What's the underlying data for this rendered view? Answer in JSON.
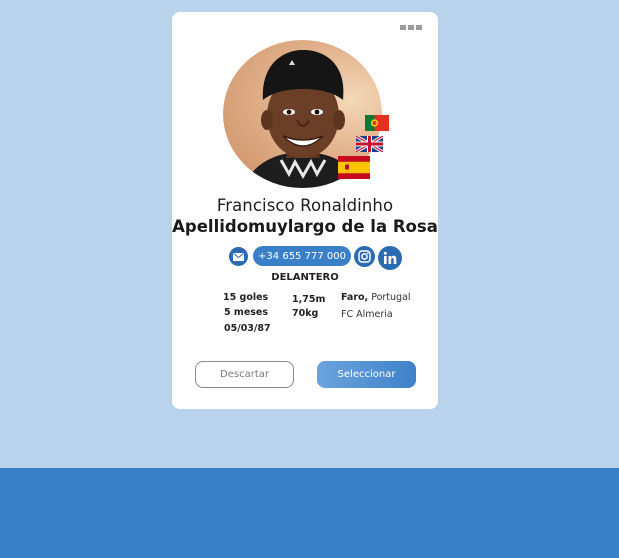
{
  "colors": {
    "background": "#b9d3ec",
    "bottom_band": "#3a80c8",
    "card": "#ffffff",
    "accent": "#3a80c8",
    "icon_blue": "#2b6bb1"
  },
  "player": {
    "first_name": "Francisco Ronaldinho",
    "last_name": "Apellidomuylargo de la Rosa",
    "photo": "player-portrait",
    "nationalities": [
      "portugal-flag",
      "united-kingdom-flag",
      "spain-flag"
    ],
    "phone": "+34 655 777 000",
    "position": "DELANTERO",
    "stats": {
      "goals": "15 goles",
      "months": "5 meses",
      "birthdate": "05/03/87",
      "height": "1,75m",
      "weight": "70kg",
      "city": "Faro,",
      "country": "Portugal",
      "club": "FC Almeria"
    }
  },
  "icons": {
    "more": "more-dots-icon",
    "mail": "mail-icon",
    "instagram": "instagram-icon",
    "linkedin": "linkedin-icon"
  },
  "actions": {
    "discard_label": "Descartar",
    "select_label": "Seleccionar"
  }
}
